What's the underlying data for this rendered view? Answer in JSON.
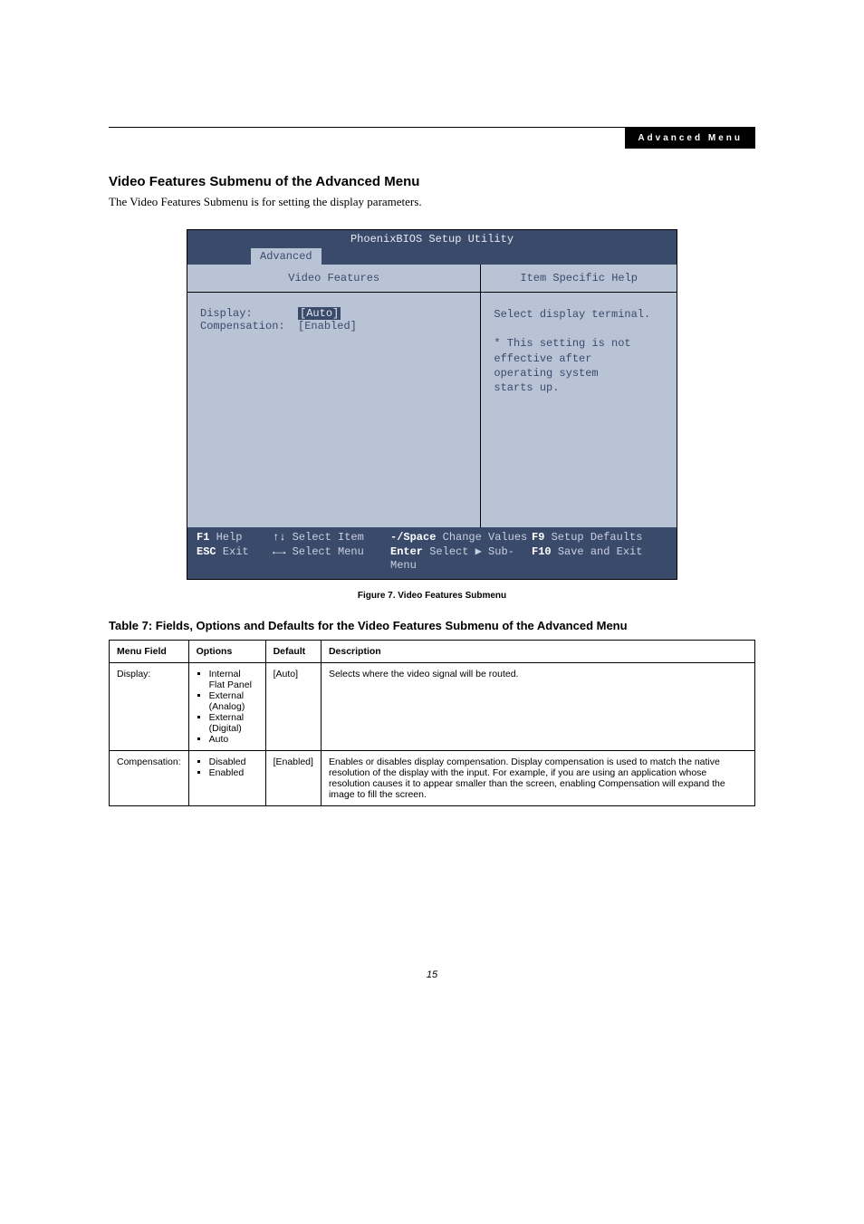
{
  "header_tag": "Advanced Menu",
  "section_title": "Video Features Submenu of the Advanced Menu",
  "intro_text": "The Video Features Submenu is for setting the display parameters.",
  "bios": {
    "title": "PhoenixBIOS Setup Utility",
    "tab_active": "Advanced",
    "left_header": "Video Features",
    "right_header": "Item Specific Help",
    "display_label": "Display:",
    "display_value": "[Auto]",
    "compensation_label": "Compensation:",
    "compensation_value": "[Enabled]",
    "help_line1": "Select display terminal.",
    "help_line2": "* This setting is not",
    "help_line3": "effective after",
    "help_line4": "operating system",
    "help_line5": "starts up.",
    "footer": {
      "f1": "F1",
      "help": "Help",
      "arrows_ud": "↑↓",
      "select_item": "Select Item",
      "minus_space": "-/Space",
      "change_values": "Change Values",
      "f9": "F9",
      "setup_defaults": "Setup Defaults",
      "esc": "ESC",
      "exit": "Exit",
      "arrows_lr": "←→",
      "select_menu": "Select Menu",
      "enter": "Enter",
      "select_submenu": "Select ▶ Sub-Menu",
      "f10": "F10",
      "save_exit": "Save and Exit"
    }
  },
  "figure_caption": "Figure 7.   Video Features Submenu",
  "table_caption": "Table 7: Fields, Options and Defaults for the Video Features Submenu of the Advanced Menu",
  "table": {
    "headers": [
      "Menu Field",
      "Options",
      "Default",
      "Description"
    ],
    "rows": [
      {
        "menu_field": "Display:",
        "options": [
          "Internal Flat Panel",
          "External (Analog)",
          "External (Digital)",
          "Auto"
        ],
        "default": "[Auto]",
        "description": "Selects where the video signal will be routed."
      },
      {
        "menu_field": "Compensation:",
        "options": [
          "Disabled",
          "Enabled"
        ],
        "default": "[Enabled]",
        "description": "Enables or disables display compensation. Display compensation is used to match the native resolution of the display with the input. For example, if you are using an application whose resolution causes it to appear smaller than the screen, enabling Compensation will expand the image to fill the screen."
      }
    ]
  },
  "page_number": "15"
}
